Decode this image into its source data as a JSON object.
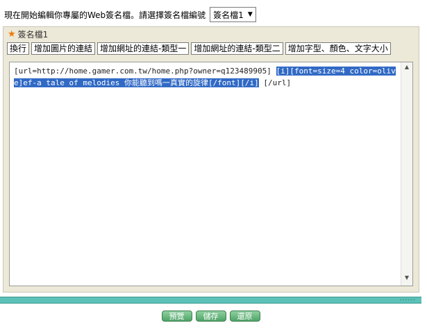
{
  "header": {
    "intro_text": "現在開始編輯你專屬的Web簽名檔。請選擇簽名檔編號",
    "select_value": "簽名檔1"
  },
  "panel": {
    "title": "簽名檔1",
    "toolbar": [
      "換行",
      "增加圖片的連結",
      "增加網址的連結-類型一",
      "增加網址的連結-類型二",
      "增加字型、顏色、文字大小"
    ]
  },
  "editor": {
    "text_plain_start": "[url=http://home.gamer.com.tw/home.php?owner=q123489905] ",
    "text_selected": "[i][font=size=4 color=olive]ef-a tale of melodies 你能聽到嗎一真實的旋律[/font][/i]",
    "text_plain_end": " [/url]"
  },
  "actions": [
    "預覽",
    "儲存",
    "還原"
  ],
  "colors": {
    "accent_teal": "#5cc1b7",
    "selection": "#316ac5",
    "button_green": "#4fa468"
  }
}
